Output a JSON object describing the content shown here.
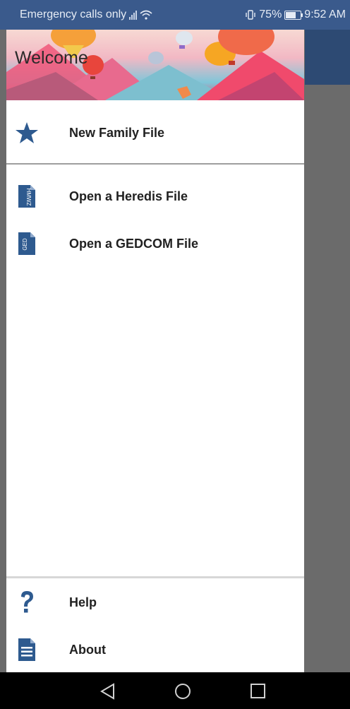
{
  "status_bar": {
    "carrier_text": "Emergency calls only",
    "battery_percent": "75%",
    "battery_level": 0.75,
    "time": "9:52 AM",
    "icons": [
      "signal-icon",
      "wifi-icon",
      "vibrate-icon",
      "battery-icon"
    ]
  },
  "drawer": {
    "header_title": "Welcome",
    "items_top": [
      {
        "label": "New Family File",
        "icon": "star-icon"
      },
      {
        "label": "Open a Heredis File",
        "icon": "file-icon",
        "icon_text": "HMWZ"
      },
      {
        "label": "Open a GEDCOM File",
        "icon": "file-icon",
        "icon_text": "GED"
      }
    ],
    "items_bottom": [
      {
        "label": "Help",
        "icon": "question-icon"
      },
      {
        "label": "About",
        "icon": "document-icon"
      }
    ]
  },
  "colors": {
    "accent": "#2e5a8f",
    "status_bar": "#3a5a8c",
    "scrim": "#6b6b6b"
  },
  "navbar": {
    "buttons": [
      "back-icon",
      "home-icon",
      "recents-icon"
    ]
  }
}
